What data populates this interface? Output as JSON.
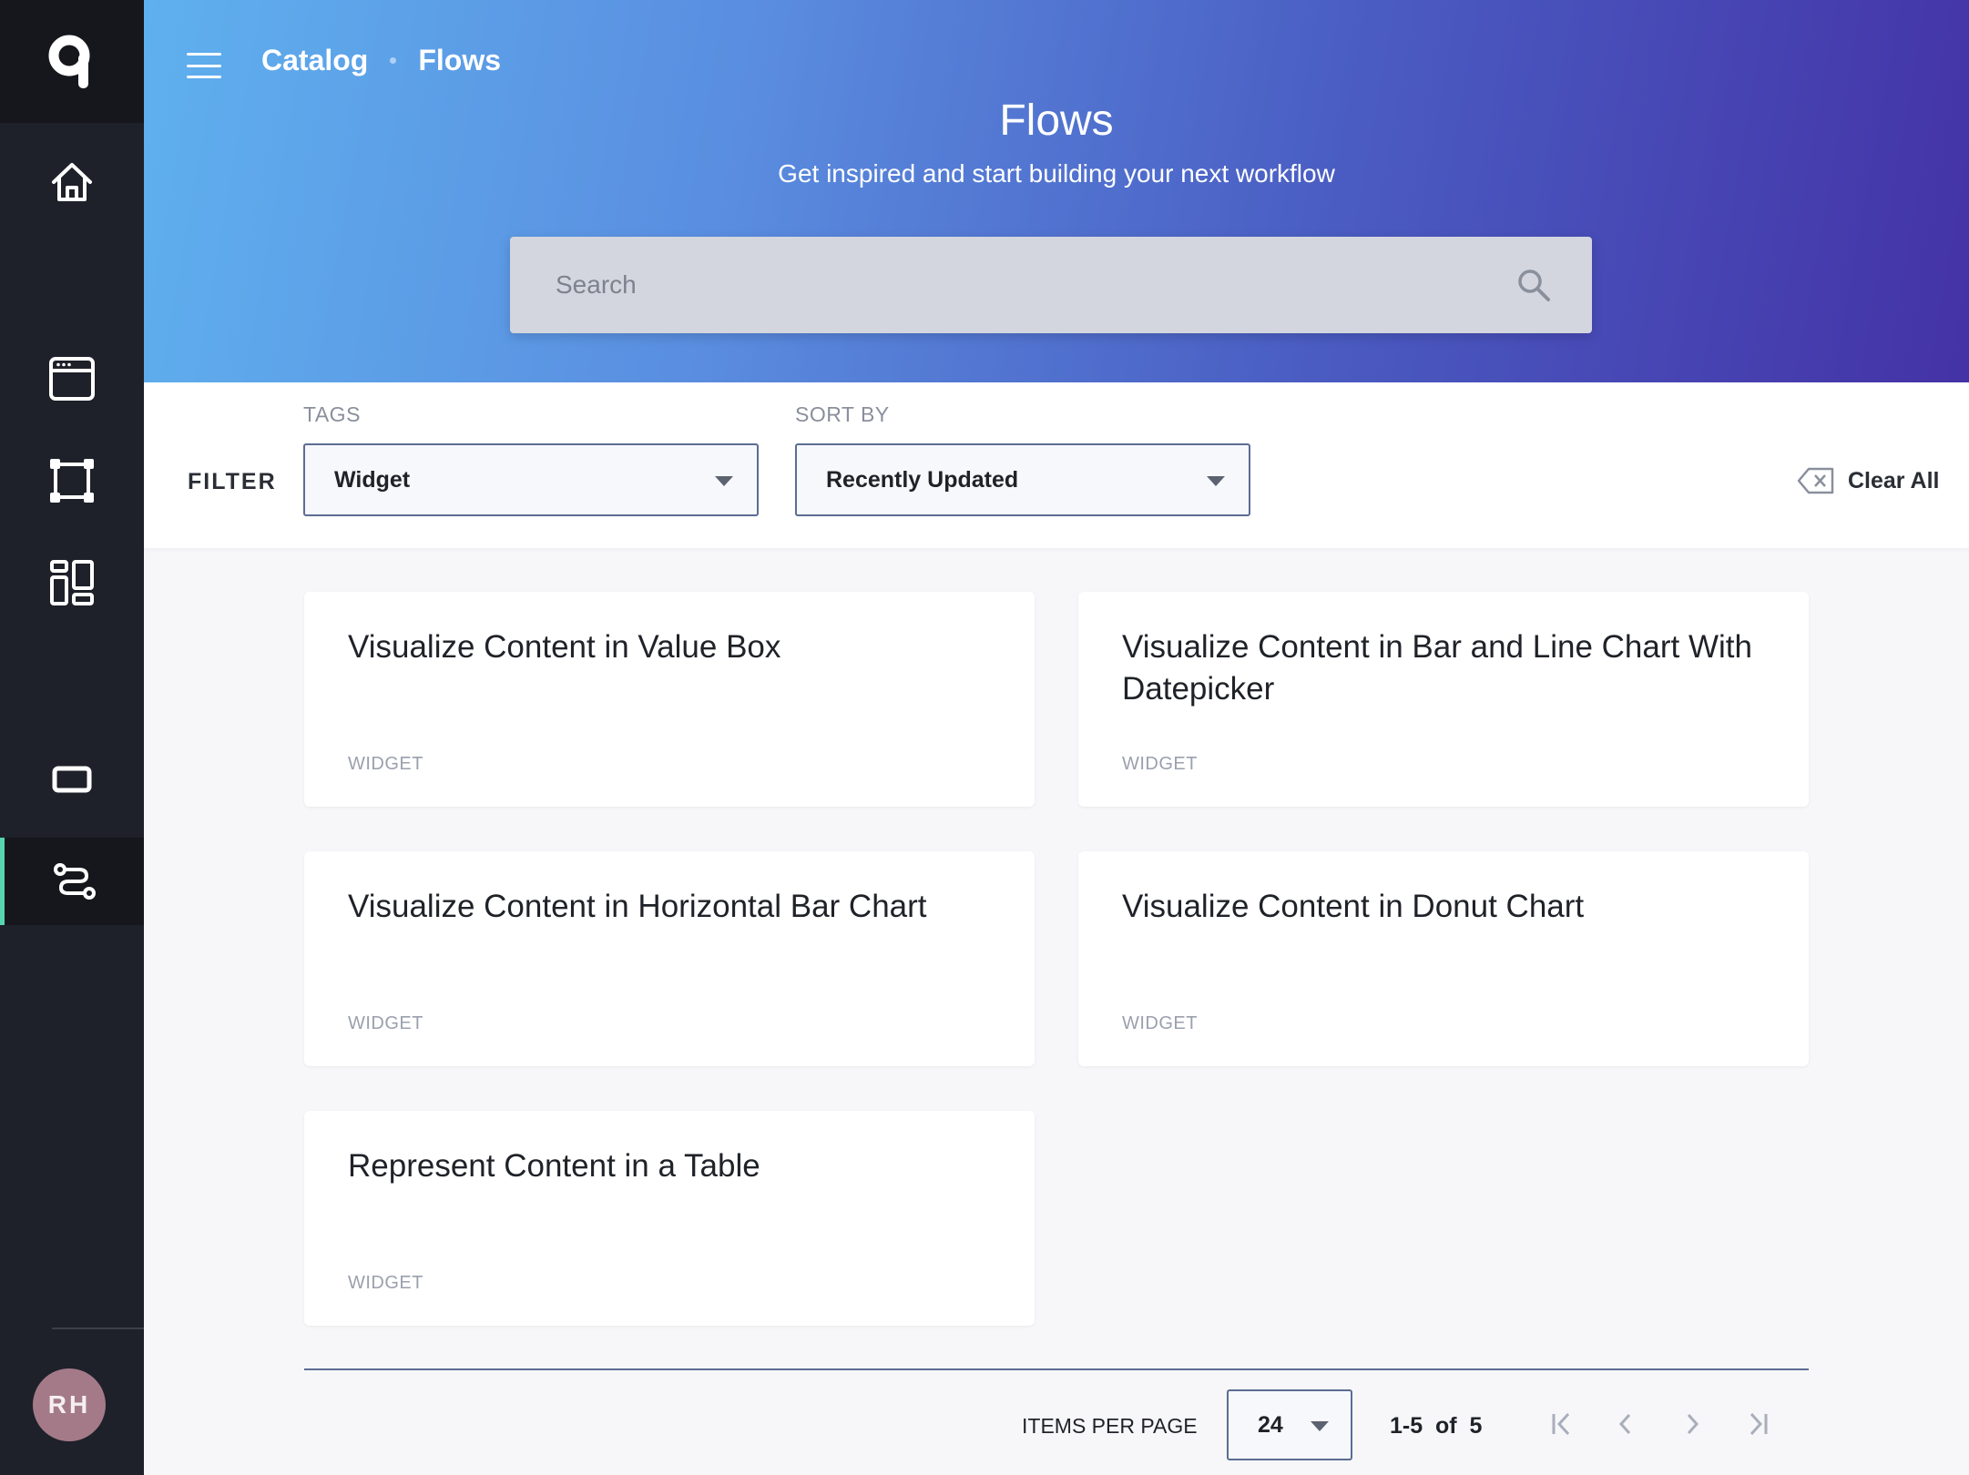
{
  "sidebar": {
    "logo_icon": "q-logo-icon",
    "items": [
      {
        "name": "home",
        "icon": "home-icon"
      },
      {
        "name": "pages",
        "icon": "browser-window-icon"
      },
      {
        "name": "canvas",
        "icon": "artboard-icon"
      },
      {
        "name": "layout",
        "icon": "dashboard-layout-icon"
      },
      {
        "name": "widgets",
        "icon": "rectangle-icon"
      },
      {
        "name": "flows",
        "icon": "flow-icon",
        "active": true
      }
    ],
    "user_initials": "RH",
    "accent_color": "#55d6b0"
  },
  "header": {
    "breadcrumb": [
      "Catalog",
      "Flows"
    ],
    "title": "Flows",
    "subtitle": "Get inspired and start building your next workflow",
    "search_placeholder": "Search"
  },
  "filters": {
    "filter_label": "FILTER",
    "tags_label": "TAGS",
    "tags_value": "Widget",
    "sort_label": "SORT BY",
    "sort_value": "Recently Updated",
    "clear_label": "Clear All"
  },
  "cards": [
    {
      "title": "Visualize Content in Value Box",
      "tag": "WIDGET"
    },
    {
      "title": "Visualize Content in Bar and Line Chart With Datepicker",
      "tag": "WIDGET"
    },
    {
      "title": "Visualize Content in Horizontal Bar Chart",
      "tag": "WIDGET"
    },
    {
      "title": "Visualize Content in Donut Chart",
      "tag": "WIDGET"
    },
    {
      "title": "Represent Content in a Table",
      "tag": "WIDGET"
    }
  ],
  "pagination": {
    "items_per_page_label": "ITEMS PER PAGE",
    "items_per_page": "24",
    "range_text": "1-5  of  5"
  }
}
